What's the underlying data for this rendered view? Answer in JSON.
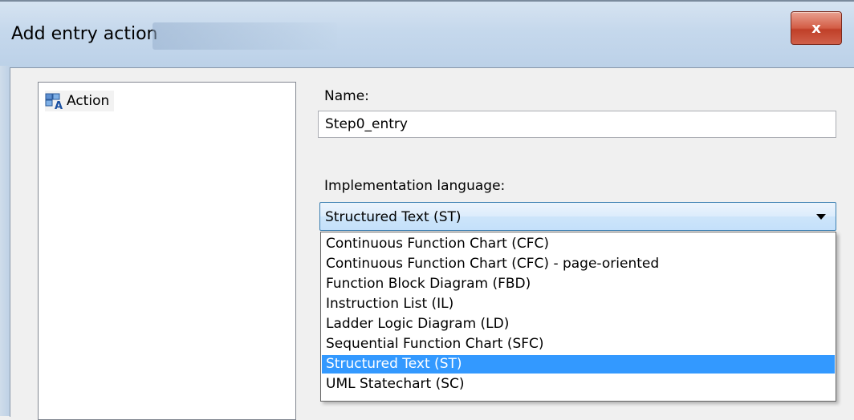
{
  "window": {
    "title": "Add entry action",
    "close_label": "x"
  },
  "tree": {
    "items": [
      {
        "label": "Action",
        "icon": "action-pou-icon"
      }
    ]
  },
  "form": {
    "name_label": "Name:",
    "name_value": "Step0_entry",
    "impl_label": "Implementation language:",
    "impl_selected": "Structured Text (ST)",
    "impl_options": [
      "Continuous Function Chart (CFC)",
      "Continuous Function Chart (CFC) - page-oriented",
      "Function Block Diagram (FBD)",
      "Instruction List (IL)",
      "Ladder Logic Diagram (LD)",
      "Sequential Function Chart (SFC)",
      "Structured Text (ST)",
      "UML Statechart (SC)"
    ],
    "highlighted_index": 6
  },
  "colors": {
    "selection": "#3399ff",
    "close_button": "#c84a33",
    "titlebar": "#c5d8ec"
  }
}
